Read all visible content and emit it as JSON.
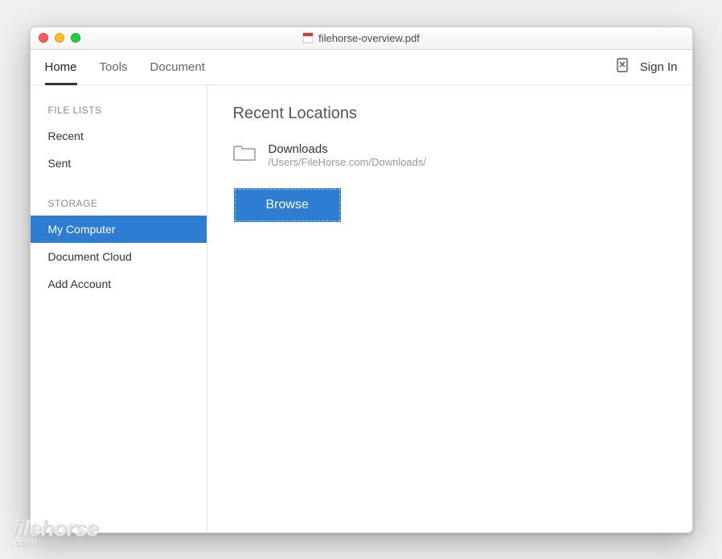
{
  "window": {
    "title": "filehorse-overview.pdf"
  },
  "toolbar": {
    "tabs": {
      "home": "Home",
      "tools": "Tools",
      "document": "Document"
    },
    "signin": "Sign In"
  },
  "sidebar": {
    "section_file_lists": "FILE LISTS",
    "recent": "Recent",
    "sent": "Sent",
    "section_storage": "STORAGE",
    "my_computer": "My Computer",
    "document_cloud": "Document Cloud",
    "add_account": "Add Account"
  },
  "main": {
    "title": "Recent Locations",
    "location": {
      "name": "Downloads",
      "path": "/Users/FileHorse.com/Downloads/"
    },
    "browse_label": "Browse"
  },
  "watermark": {
    "line1": "filehorse",
    "line2": ".com"
  }
}
